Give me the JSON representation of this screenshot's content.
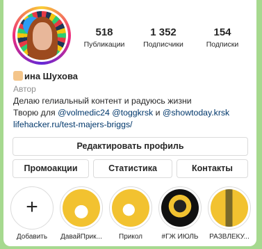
{
  "profile": {
    "name": "ина Шухова",
    "category": "Автор",
    "bio_line1": "Делаю гелиальный контент и радуюсь жизни",
    "bio_line2_prefix": "Творю для ",
    "mention1": "@volmedic24",
    "mention2": "@toggkrsk",
    "and_word": " и ",
    "mention3": "@showtoday.krsk",
    "website": "lifehacker.ru/test-majers-briggs/"
  },
  "stats": [
    {
      "value": "518",
      "label": "Публикации"
    },
    {
      "value": "1 352",
      "label": "Подписчики"
    },
    {
      "value": "154",
      "label": "Подписки"
    }
  ],
  "buttons": {
    "edit_profile": "Редактировать профиль",
    "promotions": "Промоакции",
    "statistics": "Статистика",
    "contacts": "Контакты"
  },
  "highlights": [
    {
      "label": "Добавить",
      "icon": "plus-icon"
    },
    {
      "label": "ДавайПрик...",
      "color": "#f2c230"
    },
    {
      "label": "Прикол",
      "color": "#f2c230"
    },
    {
      "label": "#ГЖ ИЮЛЬ",
      "color": "#f2c230"
    },
    {
      "label": "РАЗВЛЕКУ...",
      "color": "#f2c230"
    }
  ],
  "colors": {
    "background": "#a6d98f",
    "link": "#00376b",
    "accent": "#f2c230"
  }
}
